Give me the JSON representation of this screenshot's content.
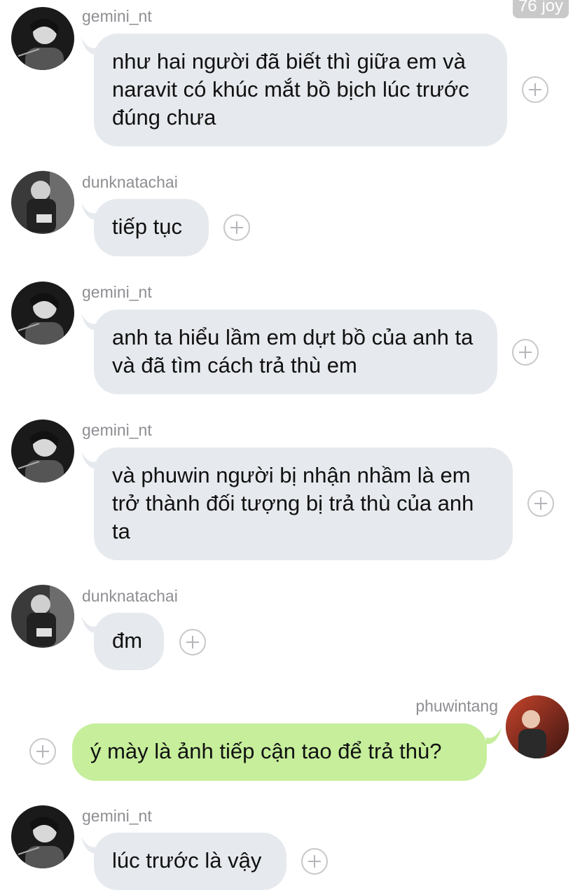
{
  "top_badge": "76 joy",
  "messages": [
    {
      "user": "gemini_nt",
      "text": "như hai người đã biết thì giữa em và naravit có khúc mắt bồ bịch lúc trước đúng chưa",
      "side": "left"
    },
    {
      "user": "dunknatachai",
      "text": "tiếp tục",
      "side": "left"
    },
    {
      "user": "gemini_nt",
      "text": "anh ta hiểu lầm em dựt bồ của anh ta và đã tìm cách trả thù em",
      "side": "left"
    },
    {
      "user": "gemini_nt",
      "text": "và phuwin người bị nhận nhầm là em trở thành đối tượng bị trả thù của anh ta",
      "side": "left"
    },
    {
      "user": "dunknatachai",
      "text": "đm",
      "side": "left"
    },
    {
      "user": "phuwintang",
      "text": "ý mày là ảnh tiếp cận tao để trả thù?",
      "side": "right"
    },
    {
      "user": "gemini_nt",
      "text": "lúc trước là vậy",
      "side": "left"
    }
  ],
  "colors": {
    "incoming_bubble": "#e6e9ed",
    "outgoing_bubble": "#c6ee9b",
    "username": "#8e8e93"
  },
  "icons": {
    "react": "plus-circle-icon",
    "avatar": "profile-photo"
  }
}
